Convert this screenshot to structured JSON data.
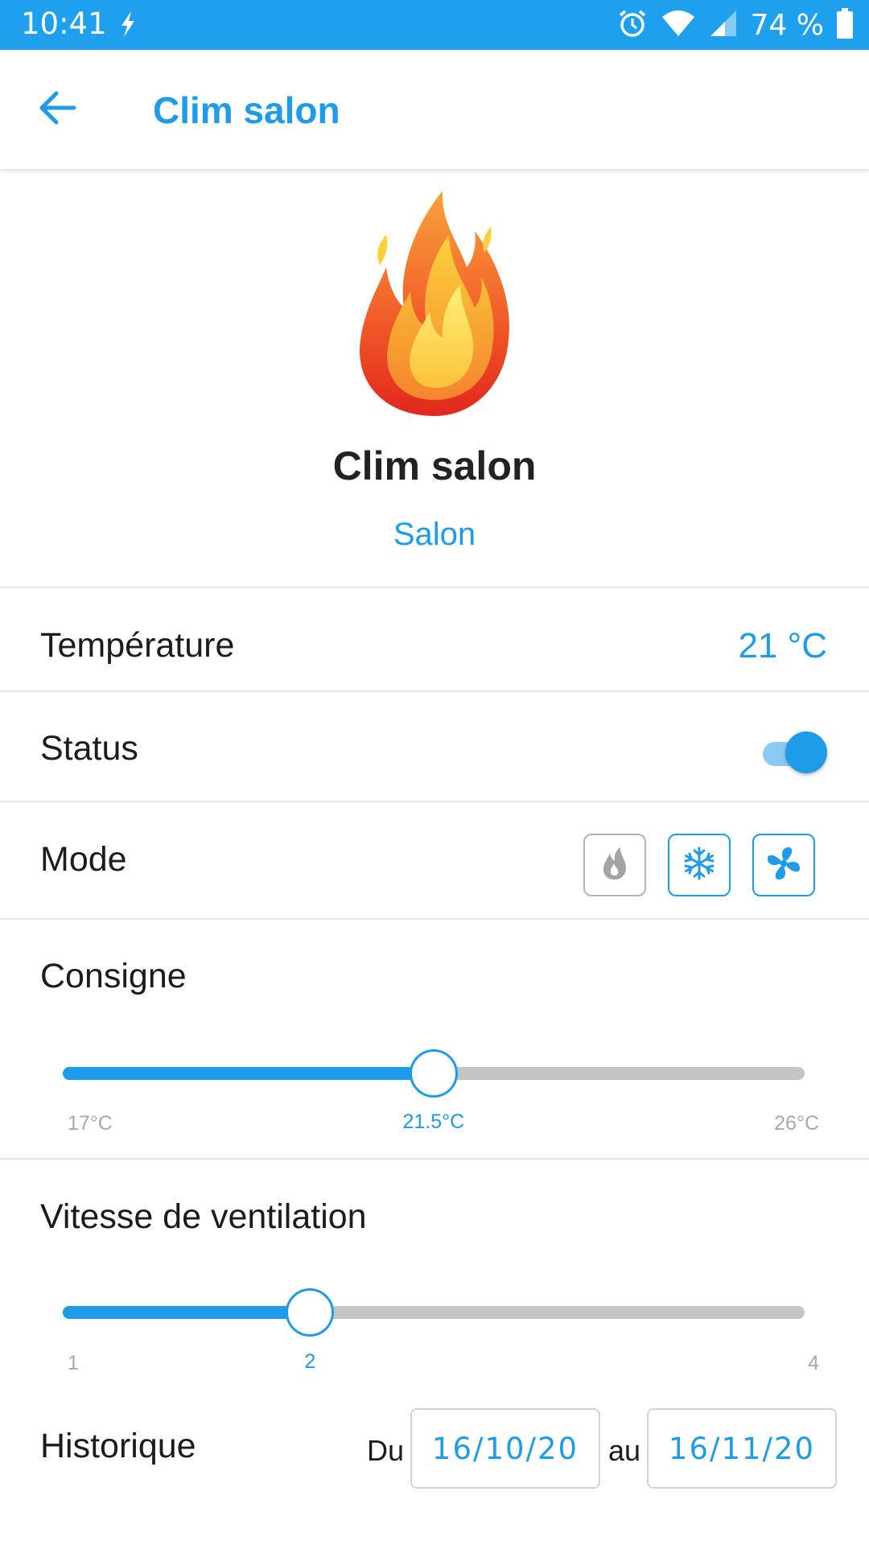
{
  "status_bar": {
    "time": "10:41",
    "battery_percent": "74 %",
    "icons": [
      "charging-bolt-icon",
      "alarm-icon",
      "wifi-icon",
      "cell-signal-icon",
      "battery-icon"
    ]
  },
  "app_bar": {
    "title": "Clim salon",
    "back_icon": "arrow-left-icon"
  },
  "device": {
    "icon": "flame-icon",
    "name": "Clim salon",
    "room": "Salon"
  },
  "temperature": {
    "label": "Température",
    "value": "21 °C"
  },
  "status": {
    "label": "Status",
    "on": true
  },
  "mode": {
    "label": "Mode",
    "options": [
      {
        "icon": "flame-mode-icon",
        "enabled": false
      },
      {
        "icon": "snowflake-icon",
        "enabled": true
      },
      {
        "icon": "fan-icon",
        "enabled": true
      }
    ]
  },
  "setpoint": {
    "label": "Consigne",
    "min": 17,
    "max": 26,
    "value": 21.5,
    "min_label": "17°C",
    "max_label": "26°C",
    "value_label": "21.5°C"
  },
  "fan_speed": {
    "label": "Vitesse de ventilation",
    "min": 1,
    "max": 4,
    "value": 2,
    "min_label": "1",
    "max_label": "4",
    "value_label": "2"
  },
  "history": {
    "label": "Historique",
    "from_label": "Du",
    "from_date": "16/10/20",
    "to_label": "au",
    "to_date": "16/11/20"
  },
  "colors": {
    "accent": "#1e9be9",
    "status_bar": "#1fa0ee",
    "track_inactive": "#c4c4c4"
  }
}
